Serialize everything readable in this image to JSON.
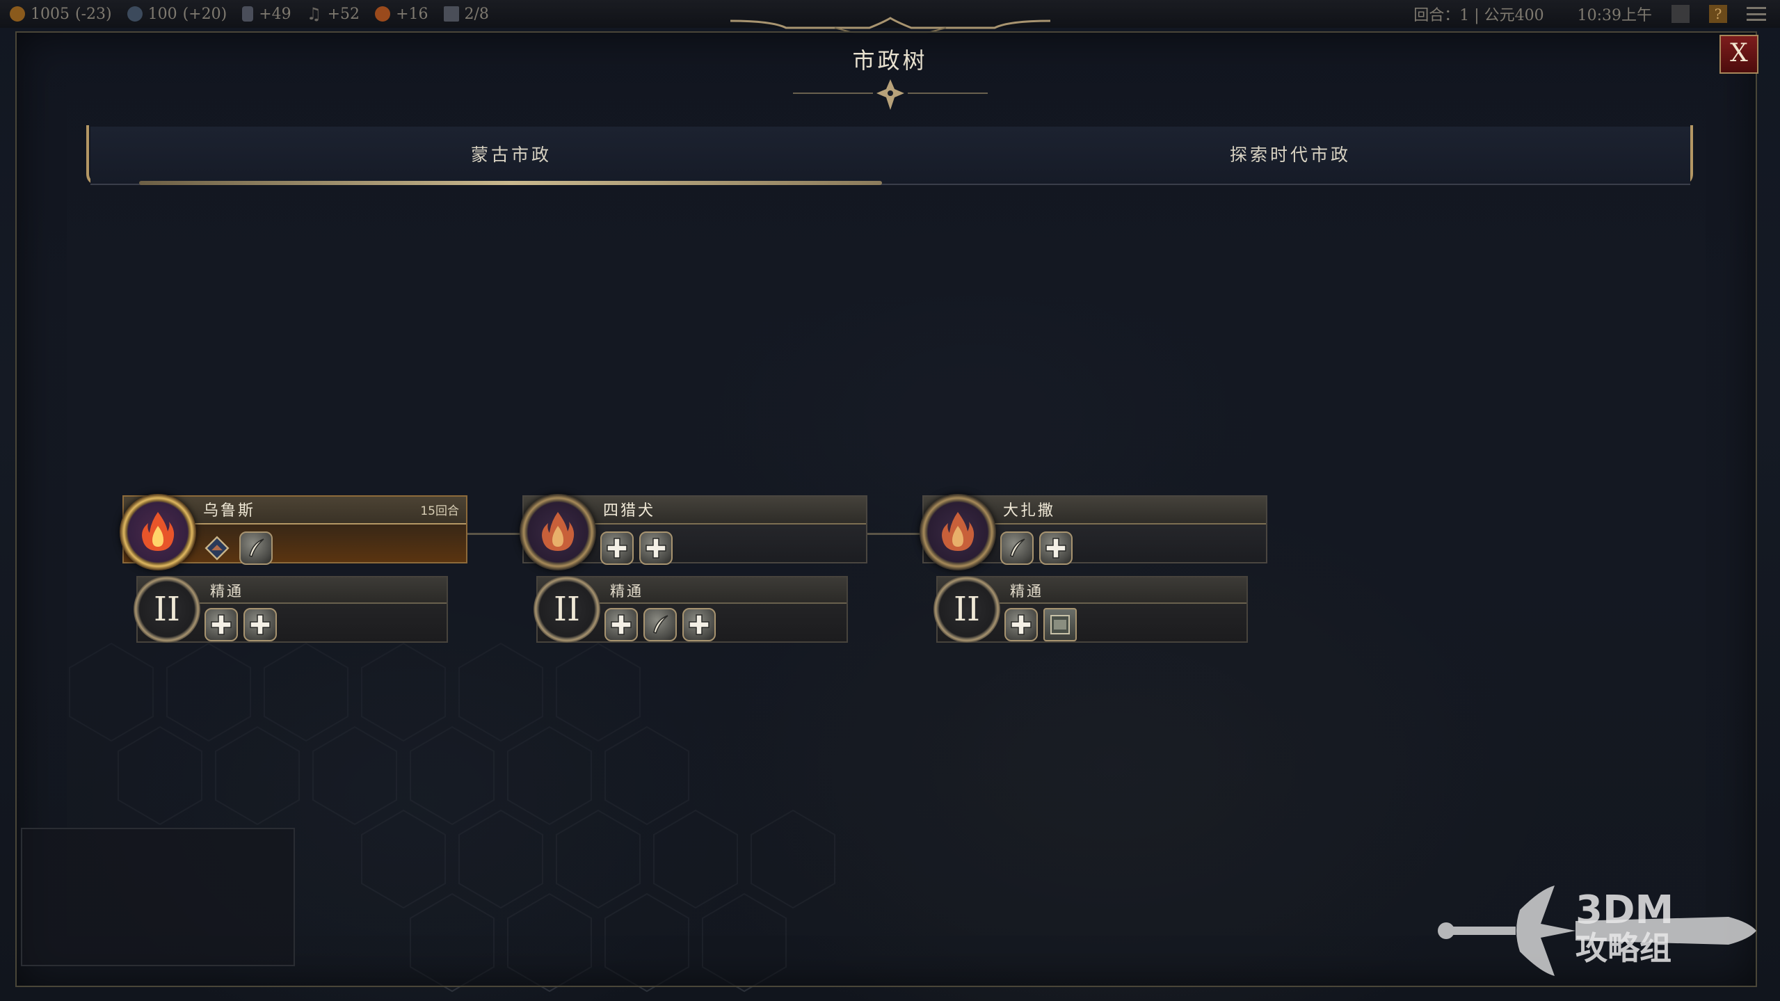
{
  "topbar": {
    "gold": "1005",
    "gold_delta": "(-23)",
    "science": "100",
    "science_delta": "(+20)",
    "culture": "+49",
    "happiness": "+52",
    "influence": "+16",
    "settlements": "2/8",
    "turn": "回合：1 | 公元400",
    "clock": "10:39上午",
    "help": "?"
  },
  "panel": {
    "title": "市政树",
    "close_label": "X"
  },
  "tabs": [
    {
      "label": "蒙古市政",
      "active": true
    },
    {
      "label": "探索时代市政",
      "active": false
    }
  ],
  "civics": [
    {
      "name": "乌鲁斯",
      "turns": "15回合",
      "state": "in-progress",
      "icon": "flame-icon",
      "bonuses": [
        "diamond-icon",
        "quill-icon"
      ],
      "mastery": {
        "numeral": "II",
        "name": "精通",
        "bonuses": [
          "plus-icon",
          "plus-icon"
        ]
      }
    },
    {
      "name": "四猎犬",
      "turns": "",
      "state": "locked",
      "icon": "flame-icon",
      "bonuses": [
        "plus-icon",
        "plus-icon"
      ],
      "mastery": {
        "numeral": "II",
        "name": "精通",
        "bonuses": [
          "plus-icon",
          "quill-icon",
          "plus-icon"
        ]
      }
    },
    {
      "name": "大扎撒",
      "turns": "",
      "state": "locked",
      "icon": "flame-icon",
      "bonuses": [
        "quill-icon",
        "plus-icon"
      ],
      "mastery": {
        "numeral": "II",
        "name": "精通",
        "bonuses": [
          "plus-icon",
          "card-icon"
        ]
      }
    }
  ],
  "watermark": {
    "brand": "3DM",
    "sub": "攻略组"
  },
  "colors": {
    "accent_gold": "#c9b88e",
    "close_red": "#7d1d1d",
    "active_node": "#5a3410"
  }
}
